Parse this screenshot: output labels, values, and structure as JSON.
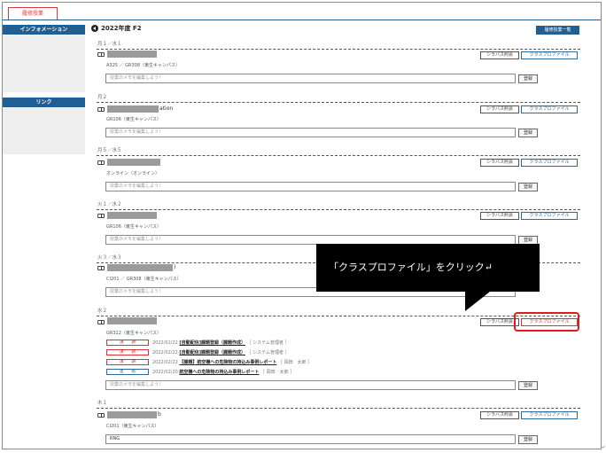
{
  "tabs": {
    "active": "履修授業"
  },
  "sidebar": {
    "info_title": "インフォメーション",
    "link_title": "リンク"
  },
  "header": {
    "title": "2022年度 F2",
    "list_button": "履修授業一覧"
  },
  "labels": {
    "syllabus": "シラバス照会",
    "profile": "クラスプロファイル",
    "save": "登録",
    "memo_placeholder": "授業のメモを編集しよう！"
  },
  "courses": [
    {
      "period": "月１／水１",
      "name": "",
      "detail": "A325 ／ GR308（東生キャンパス）"
    },
    {
      "period": "月２",
      "name": "ation",
      "detail": "GR106（東生キャンパス）"
    },
    {
      "period": "月５／水５",
      "name": "",
      "detail": "オンライン（オンライン）"
    },
    {
      "period": "火１／水２",
      "name": "",
      "detail": "GR106（東生キャンパス）"
    },
    {
      "period": "火３／水３",
      "name": ")",
      "detail": "CI201 ／ GR308（東生キャンパス）"
    },
    {
      "period": "水２",
      "name": "",
      "detail": "GR312（東生キャンパス）"
    },
    {
      "period": "木１",
      "name": "b",
      "detail": "CI201（東生キャンパス）",
      "memo_value": "RNG"
    }
  ],
  "notices": [
    {
      "badge": "課　　題",
      "date": "2022/02/22",
      "title": "[自動配信]課題登録（課題作成）",
      "meta": "［ システム管理者 ］",
      "color": "red"
    },
    {
      "badge": "課　　題",
      "date": "2022/02/22",
      "title": "[自動配信]課題登録（課題作成）",
      "meta": "［ システム管理者 ］",
      "color": "red"
    },
    {
      "badge": "課　　題",
      "date": "2022/02/22",
      "title": "【課題】航空機への危険物の持込み事例レポート",
      "meta": "［ 岡田　太郎 ］",
      "color": "red"
    },
    {
      "badge": "連　　絡",
      "date": "2022/02/20",
      "title": "航空機への危険物の持込み事例レポート",
      "meta": "［ 岡田　太郎 ］",
      "color": "blue"
    }
  ],
  "callout": {
    "text": "「クラスプロファイル」をクリック↵"
  },
  "corner_mark": "↵",
  "colors": {
    "brand": "#1f5f93",
    "highlight": "#e01b1b"
  }
}
